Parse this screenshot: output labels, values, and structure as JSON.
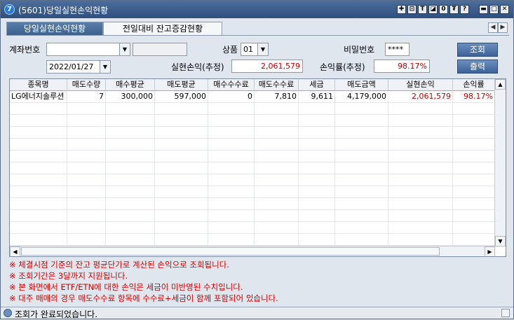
{
  "window": {
    "title": "(5601)당일실현손익현황",
    "app_icon_glyph": "7"
  },
  "title_buttons": [
    "✚",
    "⊡",
    "T",
    "◪",
    "0",
    "₮",
    "?",
    "▬",
    "□",
    "✕"
  ],
  "tabs": [
    {
      "label": "당일실현손익현황",
      "active": true
    },
    {
      "label": "전일대비 잔고증감현황",
      "active": false
    }
  ],
  "form": {
    "account_label": "계좌번호",
    "account_value": "",
    "account_name": "",
    "product_label": "상품",
    "product_value": "01",
    "password_label": "비밀번호",
    "password_value": "****",
    "date_value": "2022/01/27",
    "realized_label": "실현손익(추정)",
    "realized_value": "2,061,579",
    "rate_label": "손익률(추정)",
    "rate_value": "98.17%",
    "query_button": "조회",
    "print_button": "출력"
  },
  "grid": {
    "columns": [
      "종목명",
      "매도수량",
      "매수평균",
      "매도평균",
      "매수수수료",
      "매도수수료",
      "세금",
      "매도금액",
      "실현손익",
      "손익률"
    ],
    "rows": [
      [
        "LG에너지솔루션",
        "7",
        "300,000",
        "597,000",
        "0",
        "7,810",
        "9,611",
        "4,179,000",
        "2,061,579",
        "98.17%"
      ]
    ]
  },
  "notes": [
    "※ 체결시점 기준의 잔고 평균단가로 계산된 손익으로 조회됩니다.",
    "※ 조회기간은 3달까지 지원됩니다.",
    "※ 본 화면에서 ETF/ETN에 대한 손익은 세금이 미반영된 수치입니다.",
    "※ 대주 매매의 경우 매도수수료 항목에 수수료+세금이 함께 포함되어 있습니다."
  ],
  "status": {
    "message": "조회가 완료되었습니다."
  },
  "colors": {
    "title_bar": "#3b5f8e",
    "accent_red": "#c00000",
    "note_red": "#d40000"
  }
}
